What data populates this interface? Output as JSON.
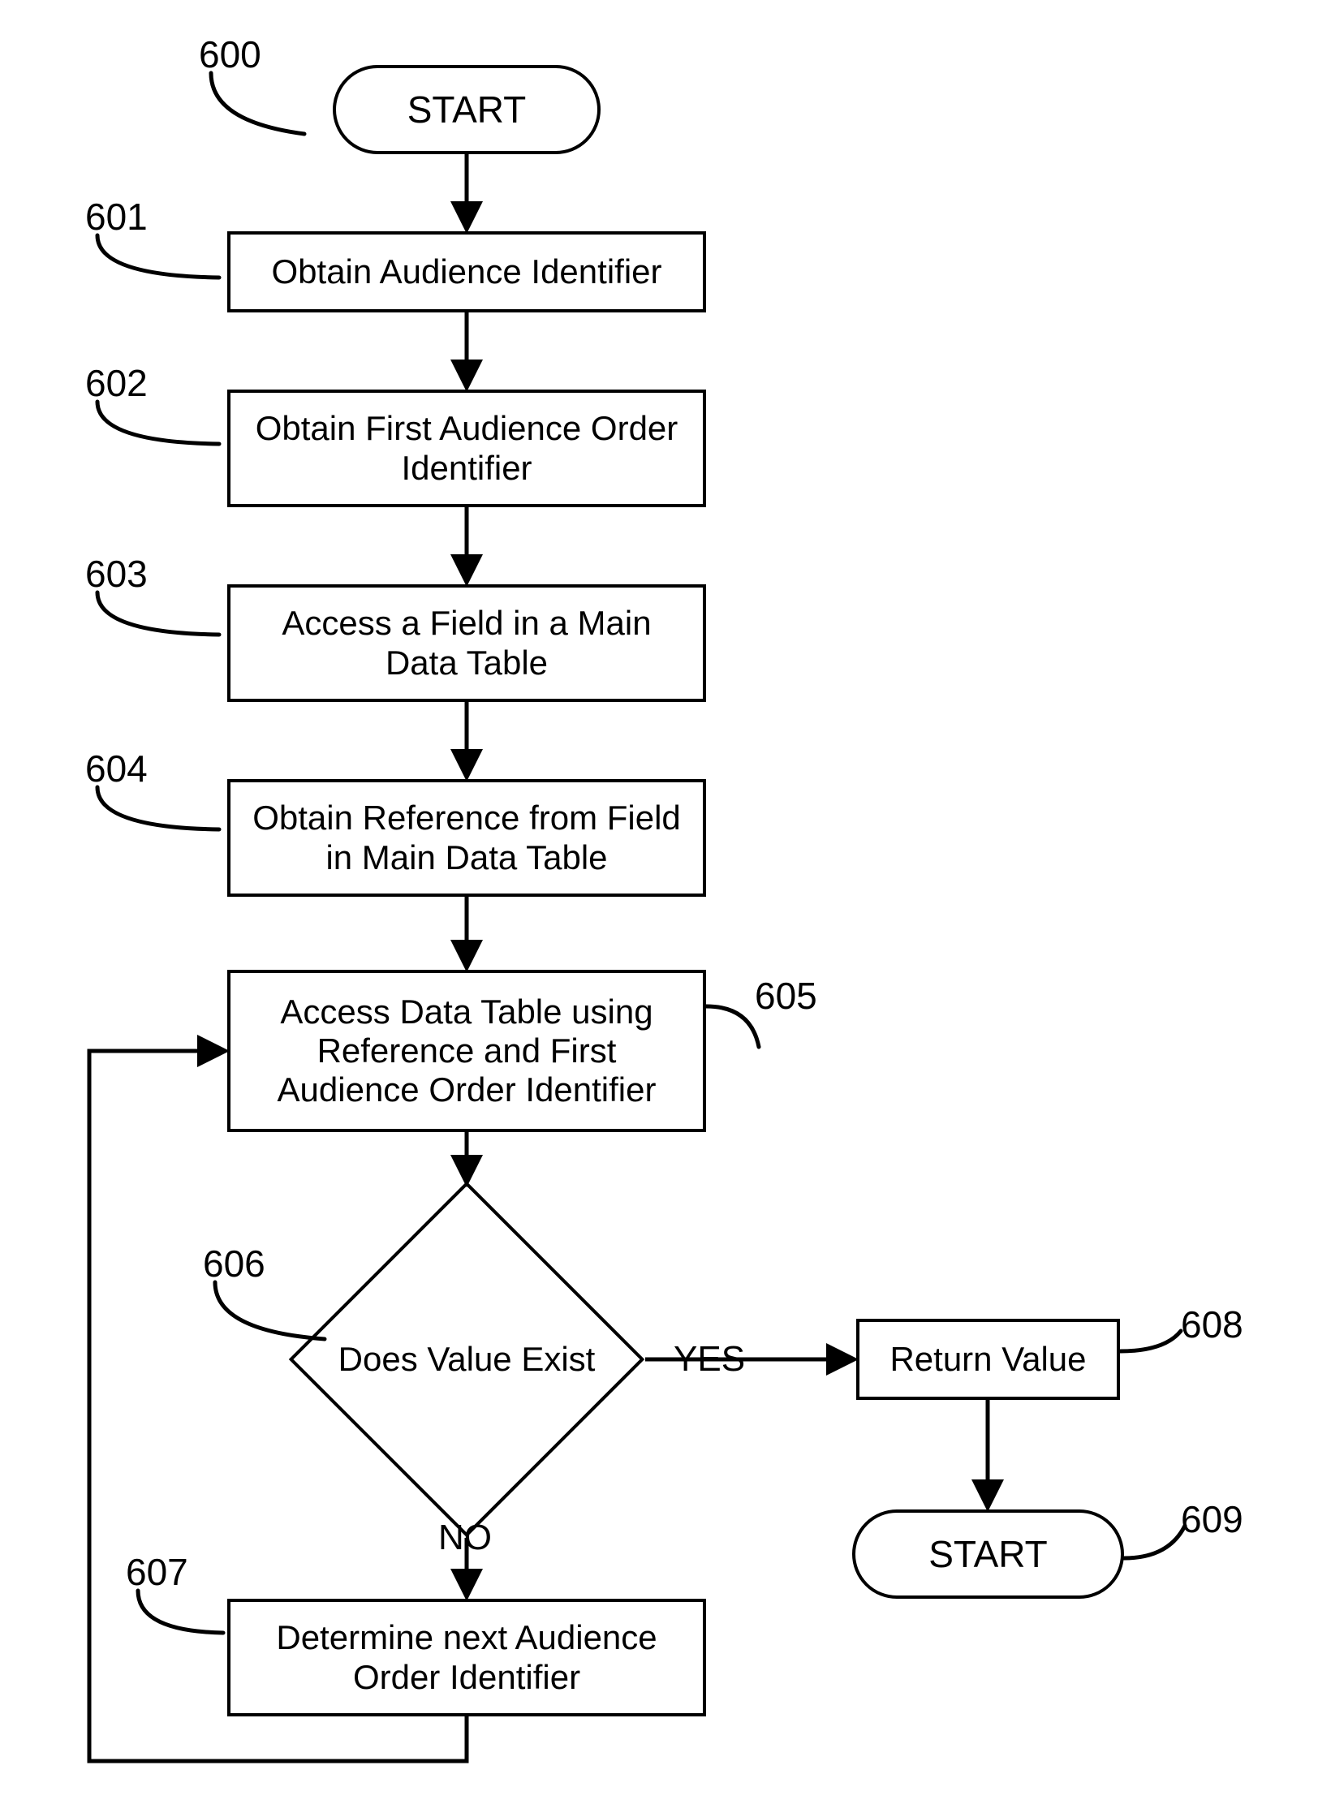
{
  "nodes": {
    "start": {
      "text": "START",
      "ref": "600"
    },
    "step1": {
      "text": "Obtain Audience Identifier",
      "ref": "601"
    },
    "step2": {
      "text": "Obtain First Audience Order Identifier",
      "ref": "602"
    },
    "step3": {
      "text": "Access a Field in a Main Data Table",
      "ref": "603"
    },
    "step4": {
      "text": "Obtain Reference from Field in Main Data Table",
      "ref": "604"
    },
    "step5": {
      "text": "Access Data Table using Reference and First Audience Order Identifier",
      "ref": "605"
    },
    "decision": {
      "text": "Does Value Exist",
      "ref": "606",
      "yes": "YES",
      "no": "NO"
    },
    "step7": {
      "text": "Determine next Audience Order Identifier",
      "ref": "607"
    },
    "return": {
      "text": "Return Value",
      "ref": "608"
    },
    "end": {
      "text": "START",
      "ref": "609"
    }
  }
}
